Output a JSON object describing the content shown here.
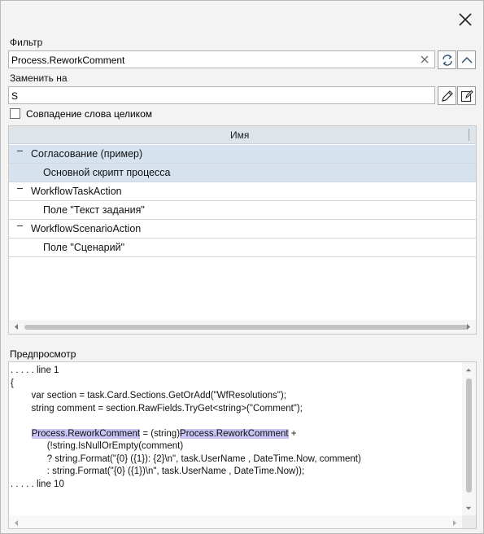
{
  "dialog": {
    "filter_label": "Фильтр",
    "filter_value": "Process.ReworkComment",
    "replace_label": "Заменить на",
    "replace_value": "S",
    "whole_word_label": "Совпадение слова целиком",
    "whole_word_checked": false
  },
  "grid": {
    "column_header": "Имя",
    "rows": [
      {
        "label": "Согласование (пример)",
        "level": 0,
        "expanded": true,
        "selected": true
      },
      {
        "label": "Основной скрипт процесса",
        "level": 1,
        "selected": true
      },
      {
        "label": "WorkflowTaskAction",
        "level": 0,
        "expanded": true,
        "selected": false
      },
      {
        "label": "Поле \"Текст задания\"",
        "level": 1,
        "selected": false
      },
      {
        "label": "WorkflowScenarioAction",
        "level": 0,
        "expanded": true,
        "selected": false
      },
      {
        "label": "Поле \"Сценарий\"",
        "level": 1,
        "selected": false
      }
    ]
  },
  "preview": {
    "label": "Предпросмотр",
    "line_1": ". . . . . line 1",
    "line_2": "{",
    "line_3": "        var section = task.Card.Sections.GetOrAdd(\"WfResolutions\");",
    "line_4": "        string comment = section.RawFields.TryGet<string>(\"Comment\");",
    "line_5": "",
    "line_6_hl1": "Process.ReworkComment",
    "line_6_mid": " = (string)",
    "line_6_hl2": "Process.ReworkComment",
    "line_6_end": " +",
    "line_7": "              (!string.IsNullOrEmpty(comment)",
    "line_8": "              ? string.Format(\"{0} ({1}): {2}\\n\", task.UserName , DateTime.Now, comment)",
    "line_9": "              : string.Format(\"{0} ({1})\\n\", task.UserName , DateTime.Now));",
    "line_10": ". . . . . line 10"
  },
  "icons": {
    "close": "close-icon",
    "clear": "clear-icon",
    "refresh": "refresh-icon",
    "collapse": "chevron-up-icon",
    "edit": "pencil-icon",
    "edit_text": "edit-document-icon"
  },
  "colors": {
    "selection": "#d6e3ef",
    "highlight": "#c8c5f4",
    "header": "#dde4ea"
  }
}
